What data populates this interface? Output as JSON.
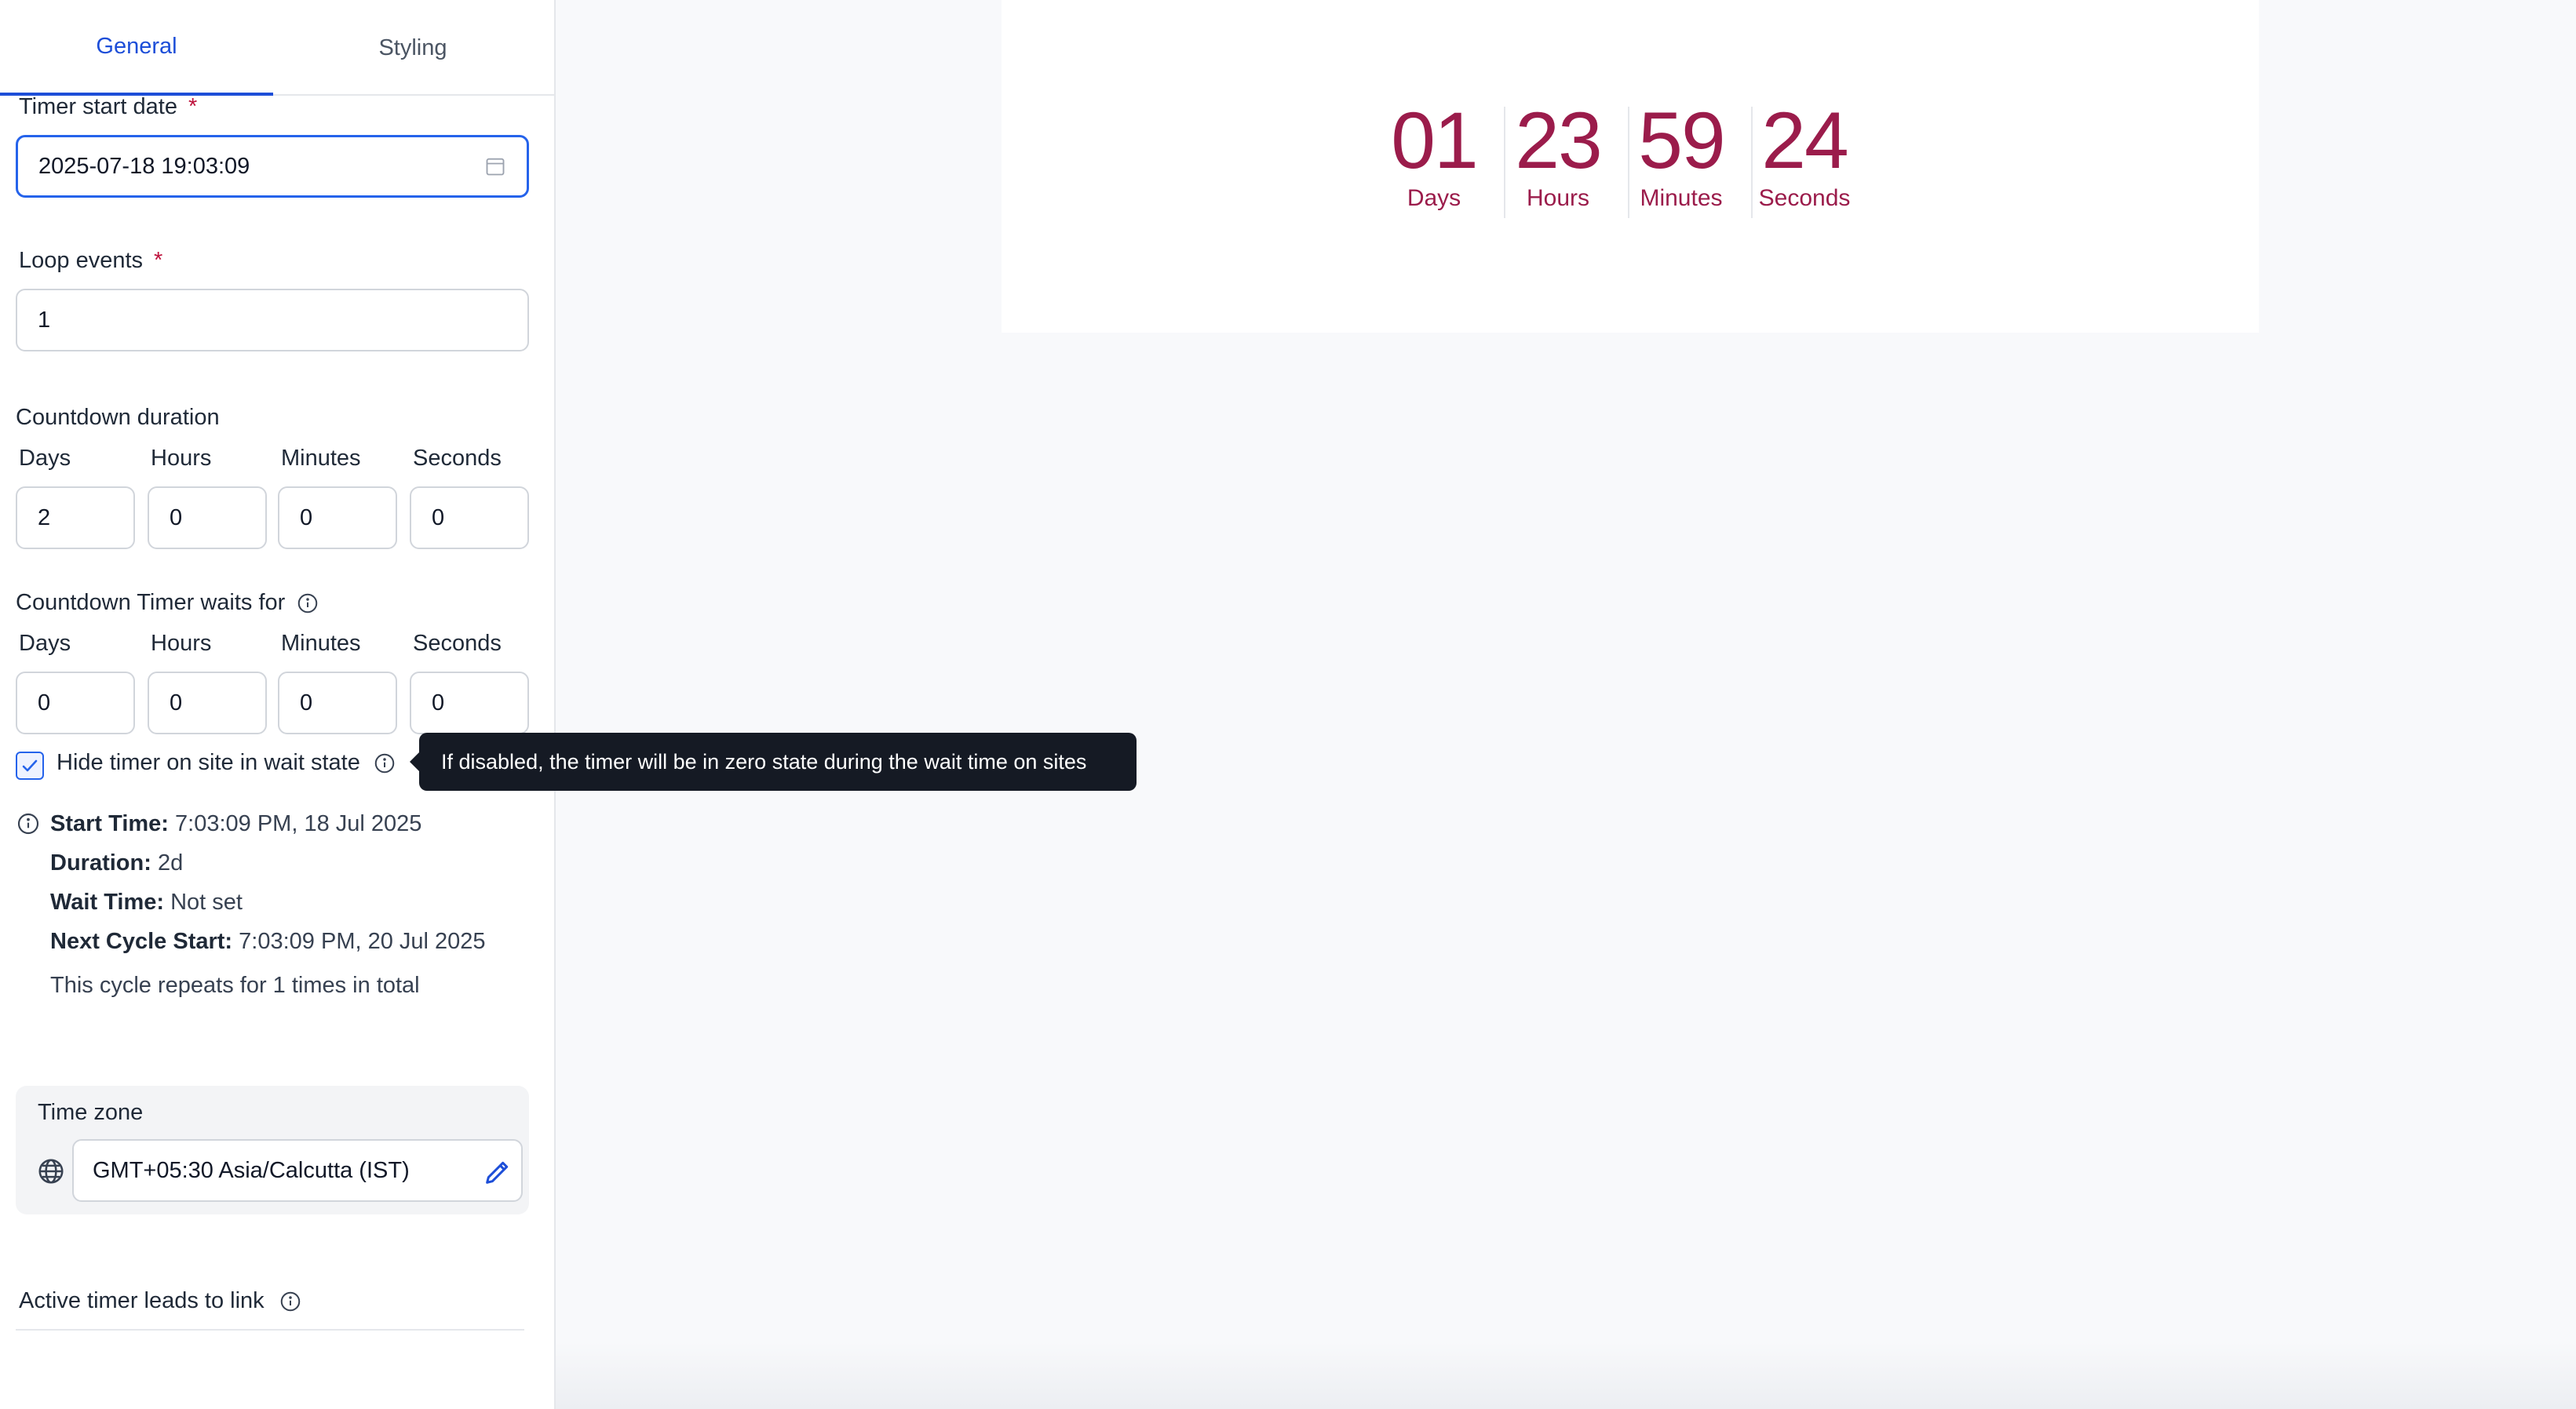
{
  "tabs": [
    {
      "label": "General",
      "active": true
    },
    {
      "label": "Styling",
      "active": false
    }
  ],
  "timer_start": {
    "label": "Timer start date",
    "required_mark": "*",
    "value": "2025-07-18 19:03:09",
    "icon": "calendar-icon"
  },
  "loop_events": {
    "label": "Loop events",
    "required_mark": "*",
    "value": "1"
  },
  "countdown_duration": {
    "label": "Countdown duration",
    "fields": [
      {
        "label": "Days",
        "value": "2"
      },
      {
        "label": "Hours",
        "value": "0"
      },
      {
        "label": "Minutes",
        "value": "0"
      },
      {
        "label": "Seconds",
        "value": "0"
      }
    ]
  },
  "wait_for": {
    "label": "Countdown Timer waits for",
    "fields": [
      {
        "label": "Days",
        "value": "0"
      },
      {
        "label": "Hours",
        "value": "0"
      },
      {
        "label": "Minutes",
        "value": "0"
      },
      {
        "label": "Seconds",
        "value": "0"
      }
    ]
  },
  "hide_timer": {
    "label": "Hide timer on site in wait state",
    "checked": true,
    "tooltip": "If disabled, the timer will be in zero state during the wait time on sites"
  },
  "summary": {
    "start_label": "Start Time:",
    "start_value": "7:03:09 PM, 18 Jul 2025",
    "duration_label": "Duration:",
    "duration_value": "2d",
    "wait_label": "Wait Time:",
    "wait_value": "Not set",
    "next_label": "Next Cycle Start:",
    "next_value": "7:03:09 PM, 20 Jul 2025",
    "repeat_text": "This cycle repeats for 1 times in total"
  },
  "timezone": {
    "label": "Time zone",
    "value": "GMT+05:30 Asia/Calcutta (IST)"
  },
  "active_link": {
    "label": "Active timer leads to link"
  },
  "preview": {
    "units": [
      {
        "value": "01",
        "label": "Days"
      },
      {
        "value": "23",
        "label": "Hours"
      },
      {
        "value": "59",
        "label": "Minutes"
      },
      {
        "value": "24",
        "label": "Seconds"
      }
    ],
    "accent_color": "#9b1c4b"
  },
  "colors": {
    "primary": "#1d4ed8",
    "required": "#be123c",
    "tooltip_bg": "#151a24"
  }
}
